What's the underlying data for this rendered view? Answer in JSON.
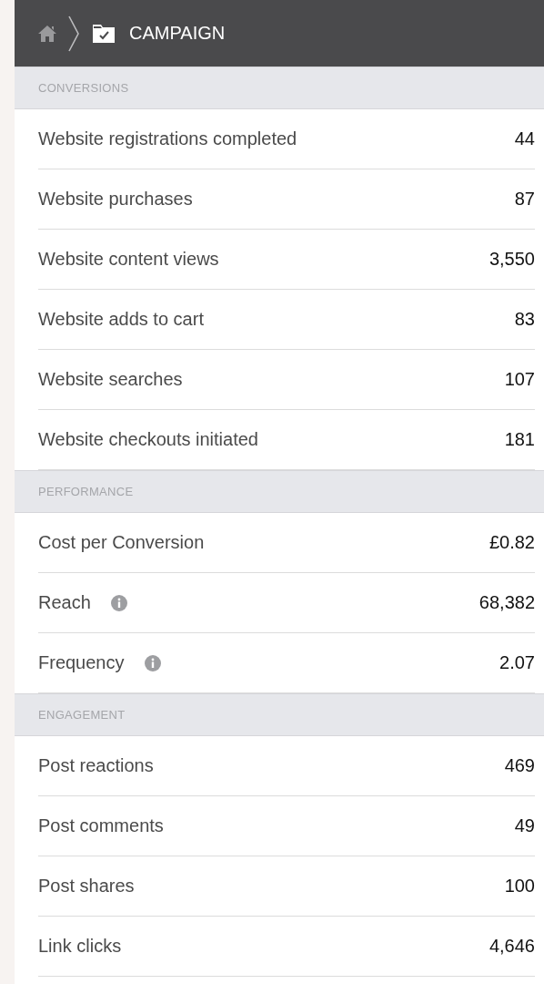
{
  "header": {
    "title": "CAMPAIGN"
  },
  "sections": [
    {
      "title": "CONVERSIONS",
      "rows": [
        {
          "label": "Website registrations completed",
          "value": "44",
          "info": false
        },
        {
          "label": "Website purchases",
          "value": "87",
          "info": false
        },
        {
          "label": "Website content views",
          "value": "3,550",
          "info": false
        },
        {
          "label": "Website adds to cart",
          "value": "83",
          "info": false
        },
        {
          "label": "Website searches",
          "value": "107",
          "info": false
        },
        {
          "label": "Website checkouts initiated",
          "value": "181",
          "info": false
        }
      ]
    },
    {
      "title": "PERFORMANCE",
      "rows": [
        {
          "label": "Cost per Conversion",
          "value": "£0.82",
          "info": false
        },
        {
          "label": "Reach",
          "value": "68,382",
          "info": true
        },
        {
          "label": "Frequency",
          "value": "2.07",
          "info": true
        }
      ]
    },
    {
      "title": "ENGAGEMENT",
      "rows": [
        {
          "label": "Post reactions",
          "value": "469",
          "info": false
        },
        {
          "label": "Post comments",
          "value": "49",
          "info": false
        },
        {
          "label": "Post shares",
          "value": "100",
          "info": false
        },
        {
          "label": "Link clicks",
          "value": "4,646",
          "info": false
        }
      ]
    }
  ]
}
